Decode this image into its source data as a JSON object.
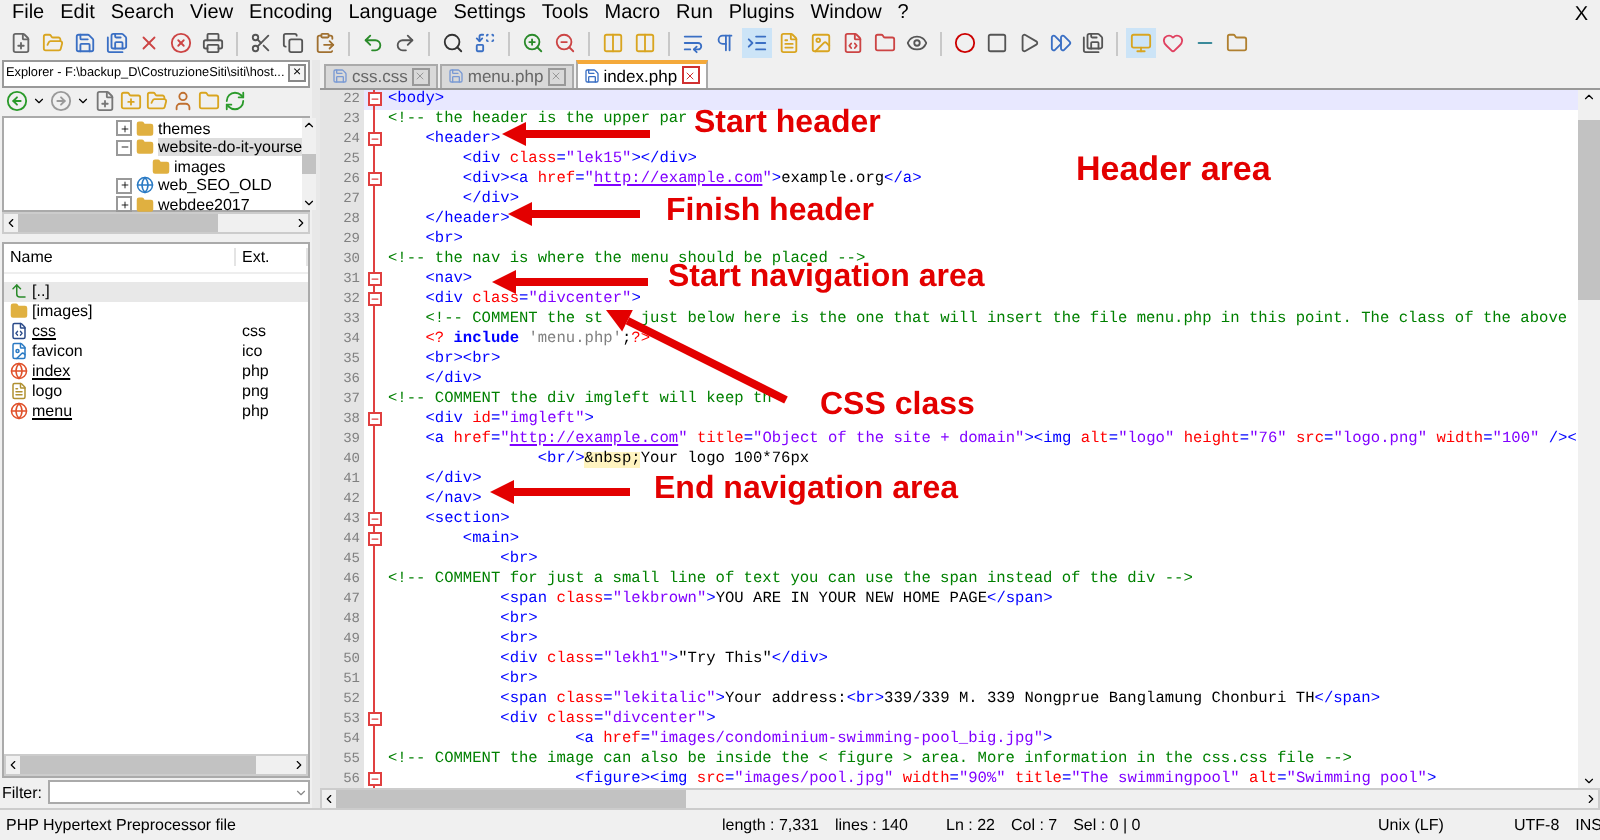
{
  "menu": [
    "File",
    "Edit",
    "Search",
    "View",
    "Encoding",
    "Language",
    "Settings",
    "Tools",
    "Macro",
    "Run",
    "Plugins",
    "Window",
    "?"
  ],
  "menu_close": "X",
  "explorer": {
    "title": "Explorer - F:\\backup_D\\CostruzioneSiti\\siti\\host...",
    "close": "×",
    "tree": [
      {
        "label": "themes",
        "kind": "folder",
        "expanded": false,
        "selected": false
      },
      {
        "label": "website-do-it-yourse",
        "kind": "folder",
        "expanded": true,
        "selected": true,
        "children": [
          {
            "label": "images",
            "kind": "folder",
            "selected": false
          }
        ]
      },
      {
        "label": "web_SEO_OLD",
        "kind": "globe",
        "expanded": false,
        "selected": false
      },
      {
        "label": "webdee2017",
        "kind": "folder",
        "expanded": false,
        "selected": false
      }
    ],
    "columns": [
      "Name",
      "Ext."
    ],
    "files": [
      {
        "name": "[..]",
        "kind": "up",
        "selected": true,
        "open": false
      },
      {
        "name": "[images]",
        "kind": "folder",
        "selected": false,
        "open": false
      },
      {
        "name": "css",
        "ext": "css",
        "kind": "css",
        "selected": false,
        "open": true
      },
      {
        "name": "favicon",
        "ext": "ico",
        "kind": "image",
        "selected": false,
        "open": false
      },
      {
        "name": "index",
        "ext": "php",
        "kind": "php",
        "selected": false,
        "open": true
      },
      {
        "name": "logo",
        "ext": "png",
        "kind": "doc",
        "selected": false,
        "open": false
      },
      {
        "name": "menu",
        "ext": "php",
        "kind": "php",
        "selected": false,
        "open": true
      }
    ],
    "filter_label": "Filter:"
  },
  "tabs": [
    {
      "label": "css.css",
      "selected": false
    },
    {
      "label": "menu.php",
      "selected": false
    },
    {
      "label": "index.php",
      "selected": true
    }
  ],
  "editor": {
    "lines": [
      {
        "number": "22",
        "current": true,
        "fold": true,
        "tokens": [
          {
            "kind": "tag",
            "text": "<body>"
          }
        ]
      },
      {
        "number": "23",
        "tokens": [
          {
            "kind": "comment",
            "text": "<!-- the header is the upper par"
          }
        ]
      },
      {
        "number": "24",
        "fold": true,
        "tokens": [
          {
            "kind": "tag",
            "text": "    <header>"
          }
        ]
      },
      {
        "number": "25",
        "tokens": [
          {
            "kind": "tag",
            "text": "        <div "
          },
          {
            "kind": "attr",
            "text": "class"
          },
          {
            "kind": "tag",
            "text": "="
          },
          {
            "kind": "value",
            "text": "\"lek15\""
          },
          {
            "kind": "tag",
            "text": "></div>"
          }
        ]
      },
      {
        "number": "26",
        "fold": true,
        "tokens": [
          {
            "kind": "tag",
            "text": "        <div><a "
          },
          {
            "kind": "attr",
            "text": "href"
          },
          {
            "kind": "tag",
            "text": "="
          },
          {
            "kind": "value",
            "text": "\""
          },
          {
            "kind": "link",
            "text": "http://example.com"
          },
          {
            "kind": "value",
            "text": "\""
          },
          {
            "kind": "tag",
            "text": ">"
          },
          {
            "kind": "text",
            "text": "example.org"
          },
          {
            "kind": "tag",
            "text": "</a>"
          }
        ]
      },
      {
        "number": "27",
        "tokens": [
          {
            "kind": "tag",
            "text": "        </div>"
          }
        ]
      },
      {
        "number": "28",
        "tokens": [
          {
            "kind": "tag",
            "text": "    </header>"
          }
        ]
      },
      {
        "number": "29",
        "tokens": [
          {
            "kind": "tag",
            "text": "    <br>"
          }
        ]
      },
      {
        "number": "30",
        "tokens": [
          {
            "kind": "comment",
            "text": "<!-- the nav is where the menu should be placed -->"
          }
        ]
      },
      {
        "number": "31",
        "fold": true,
        "tokens": [
          {
            "kind": "tag",
            "text": "    <nav>"
          }
        ]
      },
      {
        "number": "32",
        "fold": true,
        "tokens": [
          {
            "kind": "tag",
            "text": "    <div "
          },
          {
            "kind": "attr",
            "text": "class"
          },
          {
            "kind": "tag",
            "text": "="
          },
          {
            "kind": "value",
            "text": "\"divcenter\""
          },
          {
            "kind": "tag",
            "text": ">"
          }
        ]
      },
      {
        "number": "33",
        "tokens": [
          {
            "kind": "comment",
            "text": "    <!-- COMMENT the st"
          },
          {
            "kind": "comment",
            "text": "    just below here is the one that will insert the file menu.php in this point. The class of the above"
          }
        ]
      },
      {
        "number": "34",
        "tokens": [
          {
            "kind": "php",
            "text": "    <?"
          },
          {
            "kind": "keyword",
            "text": " include"
          },
          {
            "kind": "phpstring",
            "text": " 'menu.php'"
          },
          {
            "kind": "text",
            "text": ";"
          },
          {
            "kind": "php",
            "text": "?>"
          }
        ]
      },
      {
        "number": "35",
        "tokens": [
          {
            "kind": "tag",
            "text": "    <br><br>"
          }
        ]
      },
      {
        "number": "36",
        "tokens": [
          {
            "kind": "tag",
            "text": "    </div>"
          }
        ]
      },
      {
        "number": "37",
        "tokens": [
          {
            "kind": "comment",
            "text": "<!-- COMMENT the div imgleft will keep th"
          }
        ]
      },
      {
        "number": "38",
        "fold": true,
        "tokens": [
          {
            "kind": "tag",
            "text": "    <div "
          },
          {
            "kind": "attr",
            "text": "id"
          },
          {
            "kind": "tag",
            "text": "="
          },
          {
            "kind": "value",
            "text": "\"imgleft\""
          },
          {
            "kind": "tag",
            "text": ">"
          }
        ]
      },
      {
        "number": "39",
        "tokens": [
          {
            "kind": "tag",
            "text": "    <a "
          },
          {
            "kind": "attr",
            "text": "href"
          },
          {
            "kind": "tag",
            "text": "="
          },
          {
            "kind": "value",
            "text": "\""
          },
          {
            "kind": "link",
            "text": "http://example.com"
          },
          {
            "kind": "value",
            "text": "\""
          },
          {
            "kind": "attr",
            "text": " title"
          },
          {
            "kind": "tag",
            "text": "="
          },
          {
            "kind": "value",
            "text": "\"Object of the site + domain\""
          },
          {
            "kind": "tag",
            "text": "><img "
          },
          {
            "kind": "attr",
            "text": "alt"
          },
          {
            "kind": "tag",
            "text": "="
          },
          {
            "kind": "value",
            "text": "\"logo\""
          },
          {
            "kind": "attr",
            "text": " height"
          },
          {
            "kind": "tag",
            "text": "="
          },
          {
            "kind": "value",
            "text": "\"76\""
          },
          {
            "kind": "attr",
            "text": " src"
          },
          {
            "kind": "tag",
            "text": "="
          },
          {
            "kind": "value",
            "text": "\"logo.png\""
          },
          {
            "kind": "attr",
            "text": " width"
          },
          {
            "kind": "tag",
            "text": "="
          },
          {
            "kind": "value",
            "text": "\"100\""
          },
          {
            "kind": "tag",
            "text": " /><"
          }
        ]
      },
      {
        "number": "40",
        "tokens": [
          {
            "kind": "tag",
            "text": "                <br/>"
          },
          {
            "kind": "entity",
            "text": "&nbsp;"
          },
          {
            "kind": "text",
            "text": "Your logo 100*76px"
          }
        ]
      },
      {
        "number": "41",
        "tokens": [
          {
            "kind": "tag",
            "text": "    </div>"
          }
        ]
      },
      {
        "number": "42",
        "tokens": [
          {
            "kind": "tag",
            "text": "    </nav>"
          }
        ]
      },
      {
        "number": "43",
        "fold": true,
        "tokens": [
          {
            "kind": "tag",
            "text": "    <section>"
          }
        ]
      },
      {
        "number": "44",
        "fold": true,
        "tokens": [
          {
            "kind": "tag",
            "text": "        <main>"
          }
        ]
      },
      {
        "number": "45",
        "tokens": [
          {
            "kind": "tag",
            "text": "            <br>"
          }
        ]
      },
      {
        "number": "46",
        "tokens": [
          {
            "kind": "comment",
            "text": "<!-- COMMENT for just a small line of text you can use the span instead of the div -->"
          }
        ]
      },
      {
        "number": "47",
        "tokens": [
          {
            "kind": "tag",
            "text": "            <span "
          },
          {
            "kind": "attr",
            "text": "class"
          },
          {
            "kind": "tag",
            "text": "="
          },
          {
            "kind": "value",
            "text": "\"lekbrown\""
          },
          {
            "kind": "tag",
            "text": ">"
          },
          {
            "kind": "text",
            "text": "YOU ARE IN YOUR NEW HOME PAGE"
          },
          {
            "kind": "tag",
            "text": "</span>"
          }
        ]
      },
      {
        "number": "48",
        "tokens": [
          {
            "kind": "tag",
            "text": "            <br>"
          }
        ]
      },
      {
        "number": "49",
        "tokens": [
          {
            "kind": "tag",
            "text": "            <br>"
          }
        ]
      },
      {
        "number": "50",
        "tokens": [
          {
            "kind": "tag",
            "text": "            <div "
          },
          {
            "kind": "attr",
            "text": "class"
          },
          {
            "kind": "tag",
            "text": "="
          },
          {
            "kind": "value",
            "text": "\"lekh1\""
          },
          {
            "kind": "tag",
            "text": ">"
          },
          {
            "kind": "text",
            "text": "\"Try This\""
          },
          {
            "kind": "tag",
            "text": "</div>"
          }
        ]
      },
      {
        "number": "51",
        "tokens": [
          {
            "kind": "tag",
            "text": "            <br>"
          }
        ]
      },
      {
        "number": "52",
        "tokens": [
          {
            "kind": "tag",
            "text": "            <span "
          },
          {
            "kind": "attr",
            "text": "class"
          },
          {
            "kind": "tag",
            "text": "="
          },
          {
            "kind": "value",
            "text": "\"lekitalic\""
          },
          {
            "kind": "tag",
            "text": ">"
          },
          {
            "kind": "text",
            "text": "Your address:"
          },
          {
            "kind": "tag",
            "text": "<br>"
          },
          {
            "kind": "text",
            "text": "339/339 M. 339 Nongprue Banglamung Chonburi TH"
          },
          {
            "kind": "tag",
            "text": "</span>"
          }
        ]
      },
      {
        "number": "53",
        "fold": true,
        "tokens": [
          {
            "kind": "tag",
            "text": "            <div "
          },
          {
            "kind": "attr",
            "text": "class"
          },
          {
            "kind": "tag",
            "text": "="
          },
          {
            "kind": "value",
            "text": "\"divcenter\""
          },
          {
            "kind": "tag",
            "text": ">"
          }
        ]
      },
      {
        "number": "54",
        "tokens": [
          {
            "kind": "tag",
            "text": "                    <a "
          },
          {
            "kind": "attr",
            "text": "href"
          },
          {
            "kind": "tag",
            "text": "="
          },
          {
            "kind": "value",
            "text": "\"images/condominium-swimming-pool_big.jpg\""
          },
          {
            "kind": "tag",
            "text": ">"
          }
        ]
      },
      {
        "number": "55",
        "tokens": [
          {
            "kind": "comment",
            "text": "<!-- COMMENT the image can also be inside the < figure > area. More information in the css.css file -->"
          }
        ]
      },
      {
        "number": "56",
        "fold": true,
        "tokens": [
          {
            "kind": "tag",
            "text": "                    <figure><img "
          },
          {
            "kind": "attr",
            "text": "src"
          },
          {
            "kind": "tag",
            "text": "="
          },
          {
            "kind": "value",
            "text": "\"images/pool.jpg\""
          },
          {
            "kind": "attr",
            "text": " width"
          },
          {
            "kind": "tag",
            "text": "="
          },
          {
            "kind": "value",
            "text": "\"90%\""
          },
          {
            "kind": "attr",
            "text": " title"
          },
          {
            "kind": "tag",
            "text": "="
          },
          {
            "kind": "value",
            "text": "\"The swimmingpool\""
          },
          {
            "kind": "attr",
            "text": " alt"
          },
          {
            "kind": "tag",
            "text": "="
          },
          {
            "kind": "value",
            "text": "\"Swimming pool\""
          },
          {
            "kind": "tag",
            "text": ">"
          }
        ]
      }
    ]
  },
  "annotations": [
    {
      "text": "Start header",
      "kind": "arrow"
    },
    {
      "text": "Finish header",
      "kind": "arrow"
    },
    {
      "text": "Start navigation area",
      "kind": "arrow"
    },
    {
      "text": "CSS class",
      "kind": "diagonal"
    },
    {
      "text": "End navigation area",
      "kind": "arrow"
    },
    {
      "text": "Header area",
      "kind": "label"
    }
  ],
  "status_bar": {
    "file_type": "PHP Hypertext Preprocessor file",
    "length": "length : 7,331",
    "lines": "lines : 140",
    "ln": "Ln : 22",
    "col": "Col : 7",
    "sel": "Sel : 0 | 0",
    "eol": "Unix (LF)",
    "encoding": "UTF-8",
    "mode": "INS"
  }
}
